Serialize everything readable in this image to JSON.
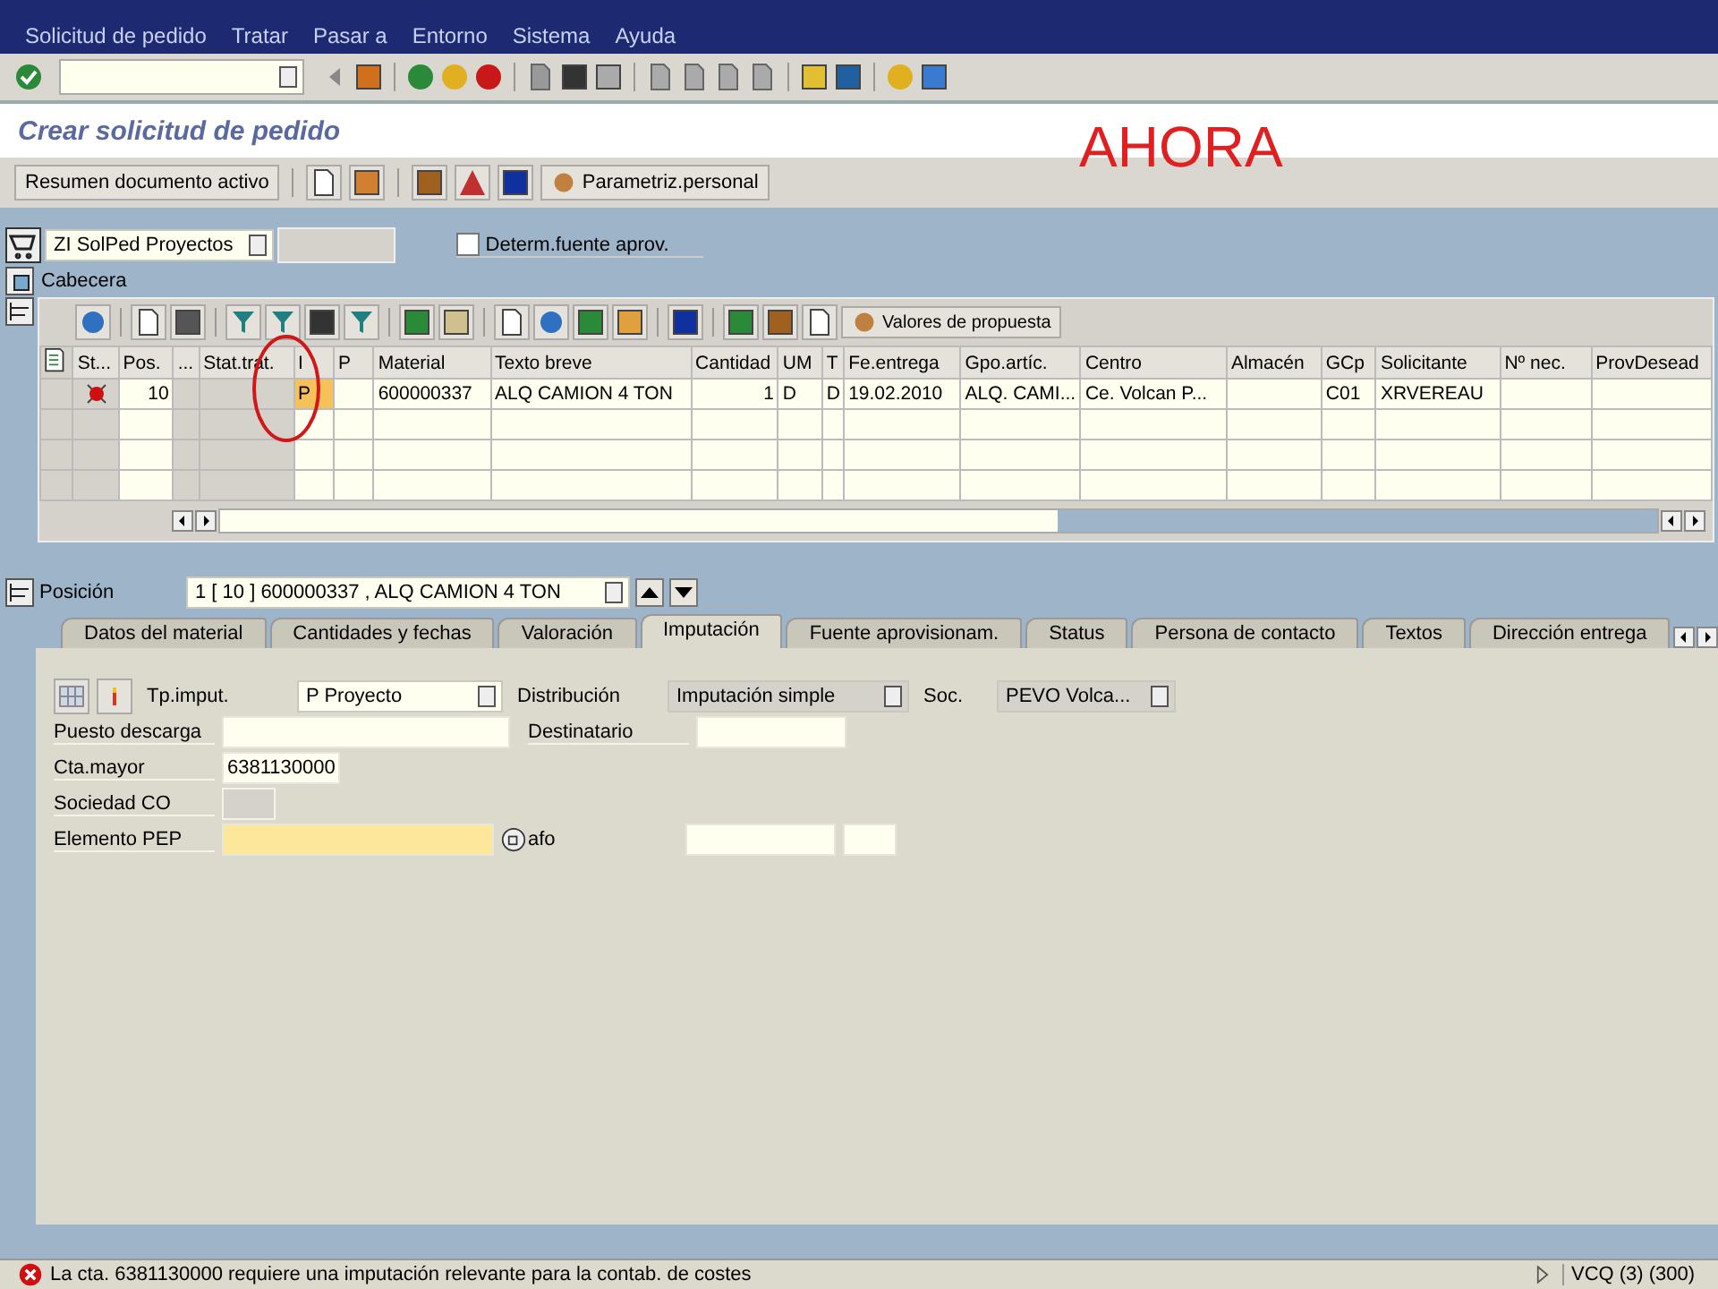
{
  "menu": [
    {
      "label": "Solicitud de pedido"
    },
    {
      "label": "Tratar"
    },
    {
      "label": "Pasar a"
    },
    {
      "label": "Entorno"
    },
    {
      "label": "Sistema"
    },
    {
      "label": "Ayuda"
    }
  ],
  "title": "Crear solicitud de pedido",
  "annotation": "AHORA",
  "app_toolbar": {
    "overview_button": "Resumen documento activo",
    "settings_button": "Parametriz.personal"
  },
  "header": {
    "doc_type": "ZI SolPed Proyectos",
    "checkbox": {
      "label": "Determ.fuente aprov.",
      "checked": false
    },
    "section": "Cabecera"
  },
  "grid_toolbar": {
    "button": "Valores de propuesta"
  },
  "table": {
    "columns": [
      {
        "label": "St...",
        "readonly": true
      },
      {
        "label": "Pos.",
        "readonly": false
      },
      {
        "label": "...",
        "readonly": true
      },
      {
        "label": "Stat.trat.",
        "readonly": true
      },
      {
        "label": "I",
        "readonly": false
      },
      {
        "label": "P",
        "readonly": false
      },
      {
        "label": "Material",
        "readonly": false
      },
      {
        "label": "Texto breve",
        "readonly": false
      },
      {
        "label": "Cantidad",
        "readonly": false
      },
      {
        "label": "UM",
        "readonly": false
      },
      {
        "label": "T",
        "readonly": false
      },
      {
        "label": "Fe.entrega",
        "readonly": false
      },
      {
        "label": "Gpo.artíc.",
        "readonly": false
      },
      {
        "label": "Centro",
        "readonly": false
      },
      {
        "label": "Almacén",
        "readonly": false
      },
      {
        "label": "GCp",
        "readonly": false
      },
      {
        "label": "Solicitante",
        "readonly": false
      },
      {
        "label": "Nº nec.",
        "readonly": false
      },
      {
        "label": "ProvDesead",
        "readonly": false
      }
    ],
    "rows": [
      {
        "error": true,
        "cells": [
          {
            "text": "",
            "highlighted": false
          },
          {
            "text": "10",
            "highlighted": false
          },
          {
            "text": "",
            "highlighted": false
          },
          {
            "text": "",
            "highlighted": false
          },
          {
            "text": "P",
            "highlighted": true
          },
          {
            "text": "",
            "highlighted": false
          },
          {
            "text": "600000337",
            "highlighted": false
          },
          {
            "text": "ALQ CAMION 4 TON",
            "highlighted": false
          },
          {
            "text": "1",
            "highlighted": false
          },
          {
            "text": "D",
            "highlighted": false
          },
          {
            "text": "D",
            "highlighted": false
          },
          {
            "text": "19.02.2010",
            "highlighted": false
          },
          {
            "text": "ALQ. CAMI...",
            "highlighted": false
          },
          {
            "text": "Ce. Volcan P...",
            "highlighted": false
          },
          {
            "text": "",
            "highlighted": false
          },
          {
            "text": "C01",
            "highlighted": false
          },
          {
            "text": "XRVEREAU",
            "highlighted": false
          },
          {
            "text": "",
            "highlighted": false
          },
          {
            "text": "",
            "highlighted": false
          }
        ]
      }
    ]
  },
  "position": {
    "label": "Posición",
    "value": "1 [ 10 ] 600000337 , ALQ CAMION 4 TON"
  },
  "tabs": [
    {
      "label": "Datos del material",
      "selected": false
    },
    {
      "label": "Cantidades y fechas",
      "selected": false
    },
    {
      "label": "Valoración",
      "selected": false
    },
    {
      "label": "Imputación",
      "selected": true
    },
    {
      "label": "Fuente aprovisionam.",
      "selected": false
    },
    {
      "label": "Status",
      "selected": false
    },
    {
      "label": "Persona de contacto",
      "selected": false
    },
    {
      "label": "Textos",
      "selected": false
    },
    {
      "label": "Dirección entrega",
      "selected": false
    }
  ],
  "imputacion": {
    "tp_label": "Tp.imput.",
    "tp_value": "P Proyecto",
    "dist_label": "Distribución",
    "dist_value": "Imputación simple",
    "soc_label": "Soc.",
    "soc_value": "PEVO Volca...",
    "puesto_label": "Puesto descarga",
    "dest_label": "Destinatario",
    "cta_label": "Cta.mayor",
    "cta_value": "6381130000",
    "soc_co_label": "Sociedad CO",
    "pep_label": "Elemento PEP",
    "pep_required": true,
    "afo_label": "afo"
  },
  "status_bar": {
    "error": true,
    "message": "La cta. 6381130000 requiere una imputación relevante para la contab. de costes",
    "system": "VCQ (3) (300)"
  }
}
